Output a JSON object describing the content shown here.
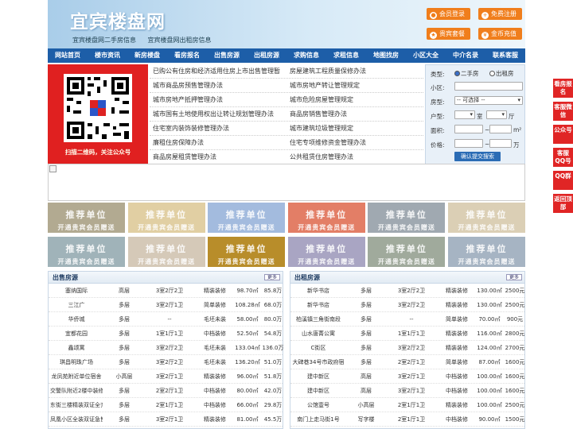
{
  "header": {
    "logo": "宜宾楼盘网",
    "sublinks": [
      "宜宾楼盘网二手房信息",
      "宜宾楼盘网出租房信息"
    ],
    "buttons": [
      {
        "label": "会员登录",
        "icon": "user-icon"
      },
      {
        "label": "免费注册",
        "icon": "register-icon"
      },
      {
        "label": "贵宾套餐",
        "icon": "vip-icon"
      },
      {
        "label": "金币充值",
        "icon": "coin-icon"
      }
    ]
  },
  "nav": [
    "网站首页",
    "楼市资讯",
    "新房楼盘",
    "看房报名",
    "出售房源",
    "出租房源",
    "求购信息",
    "求租信息",
    "地图找房",
    "小区大全",
    "中介名录",
    "联系客服"
  ],
  "qr": {
    "caption": "扫描二维码，关注公众号"
  },
  "links": [
    [
      "已购公有住房和经济适用住房上市出售管理暂",
      "房屋建筑工程质量保修办法"
    ],
    [
      "城市商品房预售管理办法",
      "城市房地产转让管理规定"
    ],
    [
      "城市房地产抵押管理办法",
      "城市危险房屋管理规定"
    ],
    [
      "城市国有土地使用权出让转让规划管理办法",
      "商品房销售管理办法"
    ],
    [
      "住宅室内装饰装修管理办法",
      "城市建筑垃圾管理规定"
    ],
    [
      "廉租住房保障办法",
      "住宅专项维修资金管理办法"
    ],
    [
      "商品房屋租赁管理办法",
      "公共租赁住房管理办法"
    ]
  ],
  "search": {
    "type_label": "类型:",
    "type_options": [
      "二手房",
      "出租房"
    ],
    "community_label": "小区:",
    "house_type_label": "房型:",
    "house_type_value": "-- 可选择 --",
    "layout_label": "户型:",
    "room_unit": "室",
    "hall_unit": "厅",
    "area_label": "面积:",
    "area_unit": "m²",
    "price_label": "价格:",
    "price_unit": "万",
    "range_sep": "~",
    "submit": "确认提交搜索"
  },
  "ads": {
    "line1": "推荐单位",
    "line2": "开通贵宾会员赠送",
    "colors": [
      "#b2aa91",
      "#e1cfa3",
      "#a3bbde",
      "#e37e66",
      "#a0a9b1",
      "#dbcfb5",
      "#a0b3b9",
      "#d5c9b8",
      "#b88d2a",
      "#a9a5c3",
      "#a0aa9c",
      "#a6b4c3"
    ]
  },
  "sale": {
    "title": "出售房源",
    "more": "更多",
    "rows": [
      [
        "塞纳国际",
        "高层",
        "3室2厅2卫",
        "精装装修",
        "98.70㎡",
        "85.8万"
      ],
      [
        "三江广",
        "多层",
        "3室2厅1卫",
        "简单装修",
        "108.28㎡",
        "68.0万"
      ],
      [
        "华侨城",
        "多层",
        "--",
        "毛坯未装",
        "58.00㎡",
        "80.0万"
      ],
      [
        "宜都花园",
        "多层",
        "1室1厅1卫",
        "中档装修",
        "52.50㎡",
        "54.8万"
      ],
      [
        "鑫颂寓",
        "多层",
        "3室2厅2卫",
        "毛坯未装",
        "133.04㎡",
        "136.0万"
      ],
      [
        "琪昌明珠广场",
        "多层",
        "3室2厅2卫",
        "毛坯未装",
        "136.20㎡",
        "51.0万"
      ],
      [
        "龙凤苑附近单位宿舍",
        "小高层",
        "3室2厅1卫",
        "精装装修",
        "96.00㎡",
        "51.8万"
      ],
      [
        "交警队附近2楼中装修",
        "多层",
        "2室2厅1卫",
        "中档装修",
        "80.00㎡",
        "42.0万"
      ],
      [
        "东街三楼精装双证全齐",
        "多层",
        "2室1厅1卫",
        "中档装修",
        "66.00㎡",
        "29.8万"
      ],
      [
        "凤凰小区全装双证急售",
        "多层",
        "3室2厅1卫",
        "精装装修",
        "81.00㎡",
        "45.5万"
      ]
    ]
  },
  "rent": {
    "title": "出租房源",
    "more": "更多",
    "rows": [
      [
        "新华书店",
        "多层",
        "3室2厅2卫",
        "精装装修",
        "130.00㎡",
        "2500元"
      ],
      [
        "新华书店",
        "多层",
        "3室2厅2卫",
        "精装装修",
        "130.00㎡",
        "2500元"
      ],
      [
        "柏溪镇三角街南段",
        "多层",
        "--",
        "简单装修",
        "70.00㎡",
        "900元"
      ],
      [
        "山水唐菁公寓",
        "多层",
        "1室1厅1卫",
        "精装装修",
        "116.00㎡",
        "2800元"
      ],
      [
        "C街区",
        "多层",
        "3室2厅2卫",
        "精装装修",
        "124.00㎡",
        "2700元"
      ],
      [
        "大碑巷34号市政府宿",
        "多层",
        "2室2厅1卫",
        "简单装修",
        "87.00㎡",
        "1600元"
      ],
      [
        "建中新区",
        "高层",
        "3室2厅1卫",
        "中档装修",
        "100.00㎡",
        "1600元"
      ],
      [
        "建中新区",
        "高层",
        "3室2厅1卫",
        "中档装修",
        "100.00㎡",
        "1600元"
      ],
      [
        "公馆壹号",
        "小高层",
        "2室1厅1卫",
        "精装装修",
        "100.00㎡",
        "2500元"
      ],
      [
        "南门上走马街1号",
        "写字楼",
        "2室1厅1卫",
        "中档装修",
        "90.00㎡",
        "1500元"
      ]
    ]
  },
  "sidebar": [
    "看房报名",
    "客服微信",
    "公众号",
    "客服QQ号",
    "QQ群",
    "返回顶部"
  ]
}
